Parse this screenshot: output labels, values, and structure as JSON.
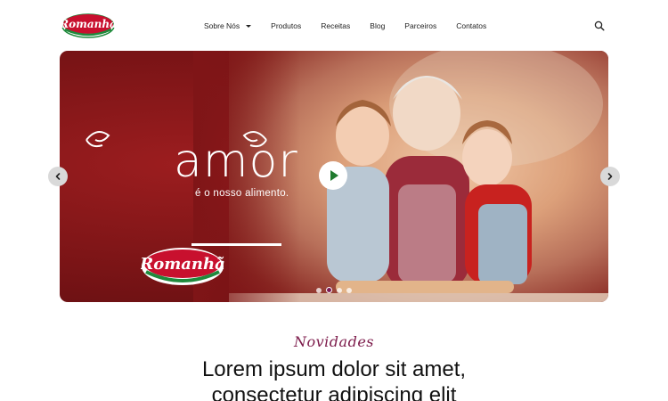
{
  "brand": {
    "name": "Romanhã",
    "primary": "#c8102e",
    "green": "#1f8a3c",
    "accent": "#7c1a4a"
  },
  "nav": {
    "items": [
      {
        "label": "Sobre Nós",
        "has_dropdown": true
      },
      {
        "label": "Produtos"
      },
      {
        "label": "Receitas"
      },
      {
        "label": "Blog"
      },
      {
        "label": "Parceiros"
      },
      {
        "label": "Contatos"
      }
    ],
    "search_icon": "search-icon"
  },
  "hero": {
    "headline": "amor",
    "subheadline": "é o nosso alimento.",
    "logo_text": "Romanhã",
    "play_icon": "play-icon",
    "prev_icon": "chevron-left-icon",
    "next_icon": "chevron-right-icon",
    "slides": 4,
    "active_slide": 2
  },
  "news": {
    "kicker": "Novidades",
    "title_line1": "Lorem ipsum dolor sit amet,",
    "title_line2": "consectetur adipiscing elit"
  }
}
